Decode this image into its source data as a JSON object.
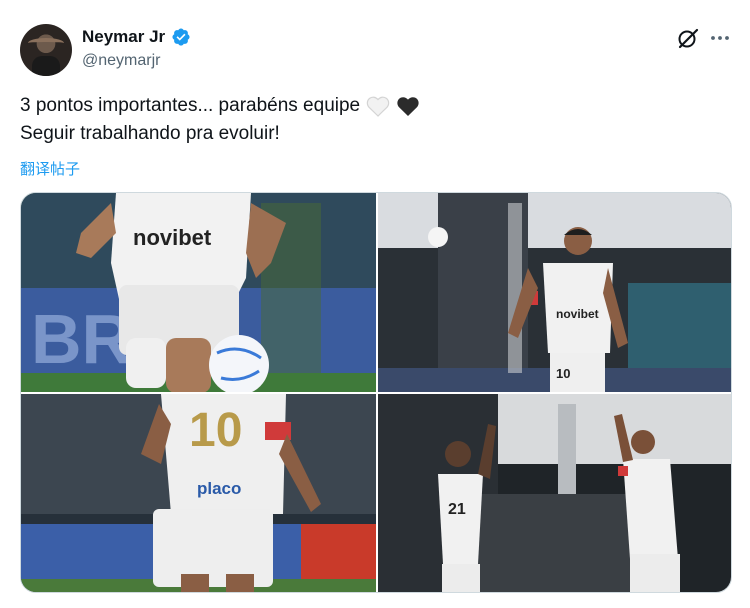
{
  "author": {
    "name": "Neymar Jr",
    "handle": "@neymarjr",
    "verified": true,
    "verified_color": "#1d9bf0"
  },
  "tweet": {
    "line1": "3 pontos importantes... parabéns equipe",
    "line2": "Seguir trabalhando pra evoluir!",
    "emojis": [
      "white-heart-icon",
      "black-heart-icon"
    ],
    "translate_label": "翻译帖子"
  },
  "media": {
    "photos": [
      {
        "shirt_sponsor": "novibet",
        "banner_text": "BRA"
      },
      {
        "shirt_sponsor": "novibet",
        "shirt_number": "10"
      },
      {
        "shirt_number": "10",
        "shirt_sponsor": "placo"
      },
      {
        "shirt_number": "21"
      }
    ]
  },
  "colors": {
    "text": "#0f1419",
    "secondary": "#536471",
    "link": "#1d9bf0"
  }
}
